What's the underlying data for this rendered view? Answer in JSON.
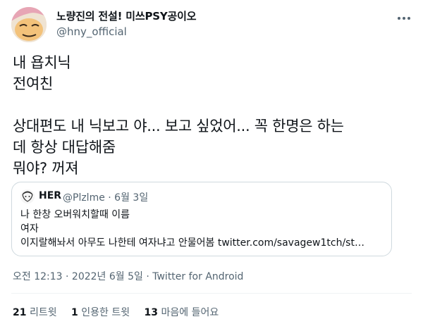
{
  "author": {
    "name": "노량진의 전설! 미쓰PSY공이오",
    "handle": "@hny_official",
    "avatar_icon": "cartoon-face-avatar"
  },
  "tweet": {
    "text": "내 욥치닉\n전여친\n\n상대편도 내 닉보고 야... 보고 싶었어... 꼭 한명은 하는\n데 항상 대답해줌\n뭐야? 꺼져"
  },
  "quote": {
    "name": "HER",
    "meta": "@Plzlme · 6월 3일",
    "lines": [
      "나 한창 오버워치할때 이름",
      "여자",
      "이지랄해놔서 아무도 나한테 여자냐고 안물어봄 twitter.com/savagew1tch/st…"
    ]
  },
  "timestamp": "오전 12:13 · 2022년 6월 5일 · Twitter for Android",
  "stats": {
    "retweets_count": "21",
    "retweets_label": "리트윗",
    "quotes_count": "1",
    "quotes_label": "인용한 트윗",
    "likes_count": "13",
    "likes_label": "마음에 들어요"
  },
  "colors": {
    "text": "#0f1419",
    "secondary": "#536471",
    "border": "#cfd9de"
  }
}
